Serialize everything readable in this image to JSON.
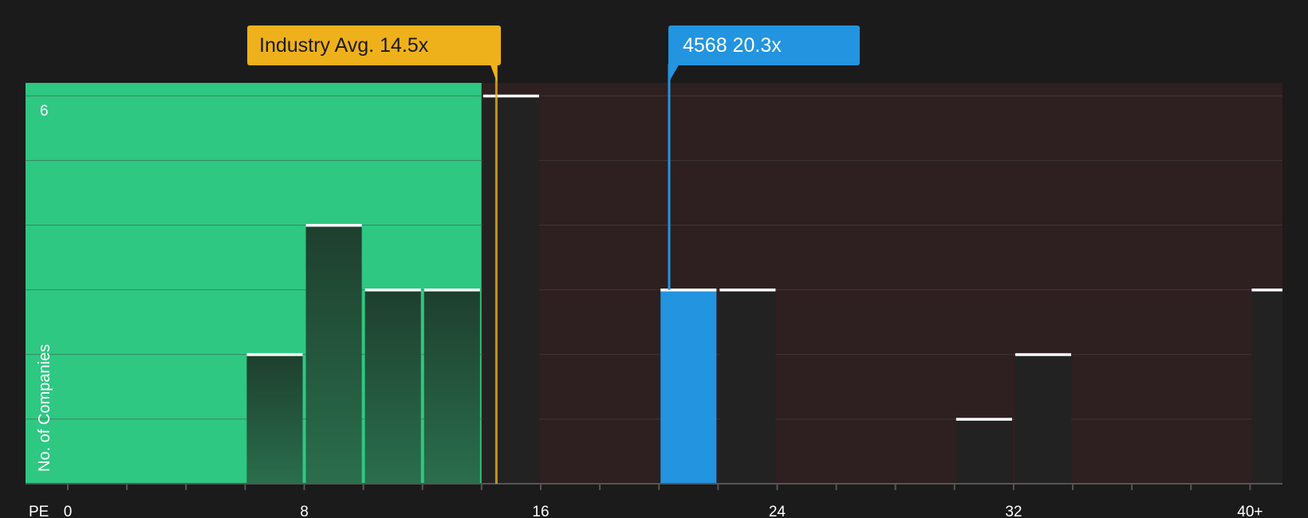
{
  "chart_data": {
    "type": "bar",
    "xlabel": "PE",
    "ylabel": "No. of Companies",
    "x_ticks": [
      "0",
      "8",
      "16",
      "24",
      "32",
      "40+"
    ],
    "y_tick_labels": [
      "6"
    ],
    "ylim": [
      0,
      6.2
    ],
    "xlim": [
      -1.4,
      41
    ],
    "grid": true,
    "bin_width": 2,
    "bars": [
      {
        "x_start": 6,
        "value": 2,
        "zone": "below"
      },
      {
        "x_start": 8,
        "value": 4,
        "zone": "below"
      },
      {
        "x_start": 10,
        "value": 3,
        "zone": "below"
      },
      {
        "x_start": 12,
        "value": 3,
        "zone": "below"
      },
      {
        "x_start": 14,
        "value": 6,
        "zone": "above"
      },
      {
        "x_start": 20,
        "value": 3,
        "zone": "highlight"
      },
      {
        "x_start": 22,
        "value": 3,
        "zone": "above"
      },
      {
        "x_start": 30,
        "value": 1,
        "zone": "above"
      },
      {
        "x_start": 32,
        "value": 2,
        "zone": "above"
      },
      {
        "x_start": 40,
        "value": 3,
        "zone": "above"
      }
    ],
    "industry_avg": {
      "value": 14.5,
      "label": "Industry Avg. 14.5x"
    },
    "company": {
      "value": 20.3,
      "label": "4568 20.3x"
    },
    "colors": {
      "background": "#1b1b1b",
      "good_zone": "#2ec882",
      "bad_zone": "#2e1f20",
      "bar_dark": "#222222",
      "bar_on_green": "#1f5e3f",
      "highlight": "#2394e0",
      "industry": "#efb11b",
      "bar_cap": "#ffffff",
      "grid": "#4a4a4a",
      "text": "#ffffff",
      "label_dark": "#1b1b1b"
    }
  }
}
